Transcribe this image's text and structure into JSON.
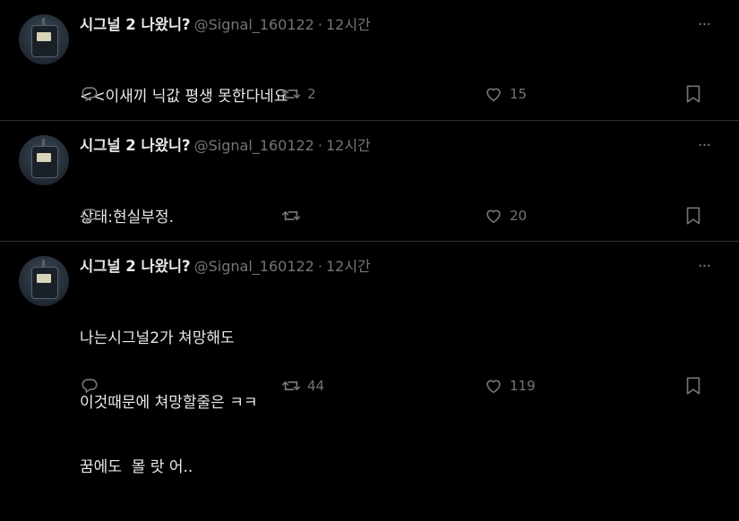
{
  "colors": {
    "background": "#000000",
    "text_primary": "#e7e9ea",
    "text_secondary": "#71767b",
    "divider": "#2f3336"
  },
  "icons": {
    "more": "more-horizontal-icon",
    "reply": "reply-icon",
    "retweet": "retweet-icon",
    "like": "heart-icon",
    "bookmark": "bookmark-icon"
  },
  "tweets": [
    {
      "name": "시그널 2 나왔니?",
      "handle": "@Signal_160122",
      "separator": "·",
      "time": "12시간",
      "more": "···",
      "lines": [
        "<<이새끼 닉값 평생 못한다네요"
      ],
      "retweets": "2",
      "likes": "15"
    },
    {
      "name": "시그널 2 나왔니?",
      "handle": "@Signal_160122",
      "separator": "·",
      "time": "12시간",
      "more": "···",
      "lines": [
        "상태:현실부정."
      ],
      "retweets": "",
      "likes": "20"
    },
    {
      "name": "시그널 2 나왔니?",
      "handle": "@Signal_160122",
      "separator": "·",
      "time": "12시간",
      "more": "···",
      "lines": [
        "나는시그널2가 쳐망해도",
        "이것때문에 쳐망할줄은 ㅋㅋ",
        "꿈에도  몰 랏 어.."
      ],
      "retweets": "44",
      "likes": "119"
    }
  ]
}
